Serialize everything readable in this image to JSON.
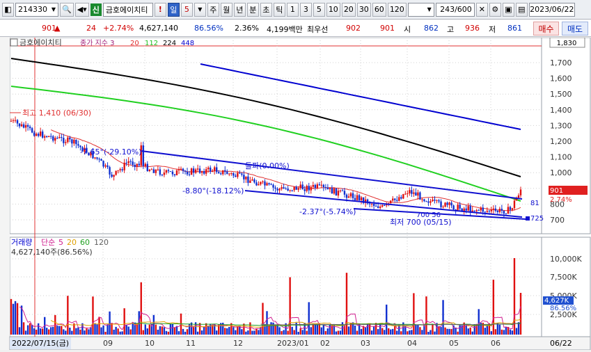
{
  "toolbar": {
    "code": "214330",
    "sin_badge": "신",
    "stock_name": "금호에이치티",
    "alert": "!",
    "period_active": "일",
    "period_count": "5",
    "period_tabs": [
      "주",
      "월",
      "년",
      "분",
      "초",
      "틱"
    ],
    "intervals": [
      "1",
      "3",
      "5",
      "10",
      "20",
      "30",
      "60",
      "120"
    ],
    "page_counter": "243/600",
    "date": "2023/06/22"
  },
  "quote": {
    "price": "901",
    "arrow": "▲",
    "change": "24",
    "change_pct": "+2.74%",
    "volume": "4,627,140",
    "vol_ratio": "86.56%",
    "turnover": "2.36%",
    "amount": "4,199백만",
    "prio_label": "최우선",
    "ask": "902",
    "bid": "901",
    "open_label": "시",
    "open": "862",
    "high_label": "고",
    "high": "936",
    "low_label": "저",
    "low": "861",
    "buy_btn": "매수",
    "sell_btn": "매도"
  },
  "price_panel": {
    "name": "금호에이치티",
    "legend_label": "종가 지수 3",
    "ma_periods": [
      "20",
      "112",
      "224",
      "448"
    ],
    "ma_colors": [
      "#e03030",
      "#20c020",
      "#000000",
      "#0000d0"
    ],
    "top_label": "1,830",
    "axis_ticks": [
      "1,700",
      "1,600",
      "1,500",
      "1,400",
      "1,300",
      "1,200",
      "1,100",
      "1,000",
      "900",
      "800",
      "700"
    ],
    "current_price": "901",
    "current_pct": "2.74%",
    "ann_high": "최고 1,410 (06/30)",
    "ann_low": "최저 700 (05/15)",
    "ann_t1": "-7.65°(-29.10%)",
    "ann_t2": "-8.80°(-18.12%)",
    "ann_t3": "-2.37°(-5.74%)",
    "ann_t4": "돌파(0.00%)",
    "ann_t5": "700 56",
    "marker_81": "81",
    "marker_725": "725"
  },
  "volume_panel": {
    "title": "거래량",
    "ma_label": "단순",
    "ma_periods": [
      "5",
      "20",
      "60",
      "120"
    ],
    "ma_colors": [
      "#d02090",
      "#e0a000",
      "#20a020",
      "#606060"
    ],
    "summary": "4,627,140주(86.56%)",
    "axis_ticks": [
      "10,000K",
      "7,500K",
      "5,000K",
      "2,500K"
    ],
    "current_vol": "4,627K",
    "current_pct": "86.56%"
  },
  "xaxis": {
    "start": "2022/07/15(금)",
    "ticks": [
      "09",
      "10",
      "11",
      "12",
      "2023/01",
      "02",
      "03",
      "04",
      "05",
      "06"
    ],
    "end": "06/22"
  }
}
